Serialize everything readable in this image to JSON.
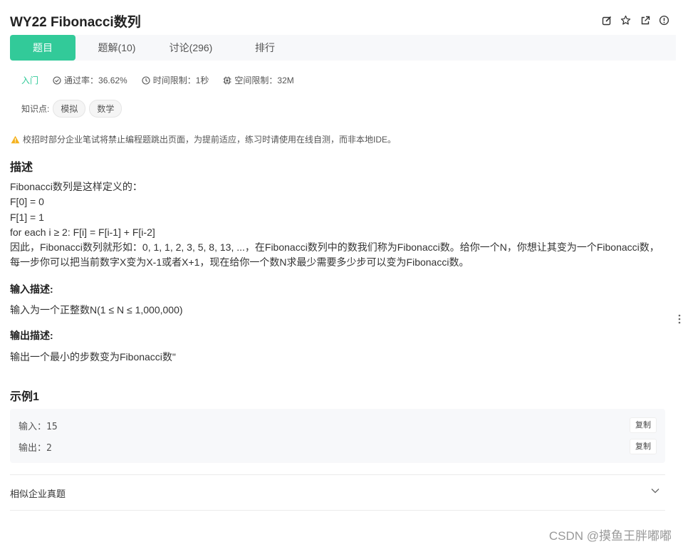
{
  "header": {
    "title": "WY22  Fibonacci数列"
  },
  "tabs": [
    {
      "label": "题目"
    },
    {
      "label": "题解(10)"
    },
    {
      "label": "讨论(296)"
    },
    {
      "label": "排行"
    }
  ],
  "meta": {
    "level": "入门",
    "pass_rate": "通过率：36.62%",
    "time_limit": "时间限制：1秒",
    "space_limit": "空间限制：32M"
  },
  "knowledge": {
    "label": "知识点:",
    "tags": [
      "模拟",
      "数学"
    ]
  },
  "warning": "校招时部分企业笔试将禁止编程题跳出页面，为提前适应，练习时请使用在线自测，而非本地IDE。",
  "description": {
    "heading": "描述",
    "lines": [
      "Fibonacci数列是这样定义的：",
      "F[0] = 0",
      "F[1] = 1",
      "for each i ≥ 2: F[i] = F[i-1] + F[i-2]",
      "因此，Fibonacci数列就形如：0, 1, 1, 2, 3, 5, 8, 13, ...，在Fibonacci数列中的数我们称为Fibonacci数。给你一个N，你想让其变为一个Fibonacci数，",
      "每一步你可以把当前数字X变为X-1或者X+1，现在给你一个数N求最少需要多少步可以变为Fibonacci数。"
    ]
  },
  "input": {
    "heading": "输入描述:",
    "text": "输入为一个正整数N(1 ≤ N ≤ 1,000,000)"
  },
  "output": {
    "heading": "输出描述:",
    "text": "输出一个最小的步数变为Fibonacci数\""
  },
  "example": {
    "heading": "示例1",
    "input_line": "输入：15",
    "output_line": "输出：2",
    "copy_label": "复制"
  },
  "similar": {
    "label": "相似企业真题"
  },
  "watermark": "CSDN @摸鱼王胖嘟嘟",
  "colors": {
    "accent": "#32ca99",
    "warning": "#f5b21e"
  }
}
